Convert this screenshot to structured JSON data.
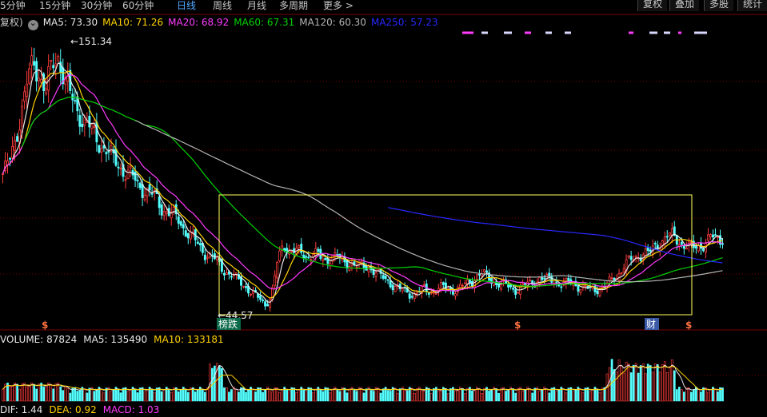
{
  "toolbar": {
    "periods": [
      {
        "label": "5分钟",
        "active": false
      },
      {
        "label": "15分钟",
        "active": false
      },
      {
        "label": "30分钟",
        "active": false
      },
      {
        "label": "60分钟",
        "active": false
      },
      {
        "label": "日线",
        "active": true
      },
      {
        "label": "周线",
        "active": false
      },
      {
        "label": "月线",
        "active": false
      },
      {
        "label": "多周期",
        "active": false
      },
      {
        "label": "更多 >",
        "active": false
      }
    ],
    "buttons": [
      "复权",
      "叠加",
      "多股",
      "统计"
    ]
  },
  "main_legend": {
    "fq_label": "复权)",
    "items": [
      {
        "text": "MA5: 73.30",
        "color": "#e8e8e8"
      },
      {
        "text": "MA10: 71.26",
        "color": "#ffd200"
      },
      {
        "text": "MA20: 68.92",
        "color": "#ff3cff"
      },
      {
        "text": "MA60: 67.31",
        "color": "#00d200"
      },
      {
        "text": "MA120: 60.30",
        "color": "#b4b4b4"
      },
      {
        "text": "MA250: 57.23",
        "color": "#2828ff"
      }
    ]
  },
  "annotations": {
    "high_label": "151.34",
    "low_label": "44.57",
    "event_tag": "榜跌",
    "finance_tag": "财",
    "signal_tags": [
      "$",
      "$",
      "$"
    ]
  },
  "volume_legend": {
    "items": [
      {
        "text": "VOLUME: 87824",
        "color": "#e8e8e8"
      },
      {
        "text": "MA5: 135490",
        "color": "#e8e8e8"
      },
      {
        "text": "MA10: 133181",
        "color": "#ffd200"
      }
    ]
  },
  "macd_legend": {
    "items": [
      {
        "text": "DIF: 1.44",
        "color": "#e8e8e8"
      },
      {
        "text": "DEA: 0.92",
        "color": "#ffd200"
      },
      {
        "text": "MACD: 1.03",
        "color": "#ff3cff"
      }
    ]
  },
  "colors": {
    "up": "#ff3c3c",
    "down": "#54ffff",
    "grid": "#7a0000",
    "box": "#ffff5a"
  },
  "chart_data": {
    "type": "candlestick",
    "price_range": [
      40,
      160
    ],
    "volume_range": [
      0,
      520000
    ],
    "high": 151.34,
    "low": 44.57,
    "close_series": [
      100,
      104,
      114,
      126,
      138,
      147,
      143,
      135,
      144,
      151,
      142,
      133,
      128,
      124,
      120,
      116,
      113,
      110,
      106,
      104,
      101,
      99,
      96,
      94,
      92,
      90,
      86,
      84,
      82,
      80,
      76,
      73,
      70,
      67,
      65,
      63,
      60,
      58,
      56,
      54,
      52,
      49,
      47,
      45,
      48,
      62,
      70,
      68,
      67,
      66,
      65,
      67,
      64,
      63,
      66,
      64,
      62,
      63,
      61,
      60,
      61,
      59,
      56,
      55,
      53,
      51,
      50,
      49,
      50,
      51,
      50,
      51,
      52,
      51,
      51,
      52,
      53,
      55,
      58,
      57,
      55,
      54,
      53,
      52,
      51,
      52,
      53,
      54,
      56,
      55,
      55,
      54,
      53,
      54,
      53,
      52,
      51,
      51,
      52,
      53,
      55,
      58,
      62,
      63,
      65,
      67,
      66,
      69,
      72,
      74,
      73,
      71,
      70,
      68,
      69,
      71,
      73,
      72,
      73
    ]
  }
}
